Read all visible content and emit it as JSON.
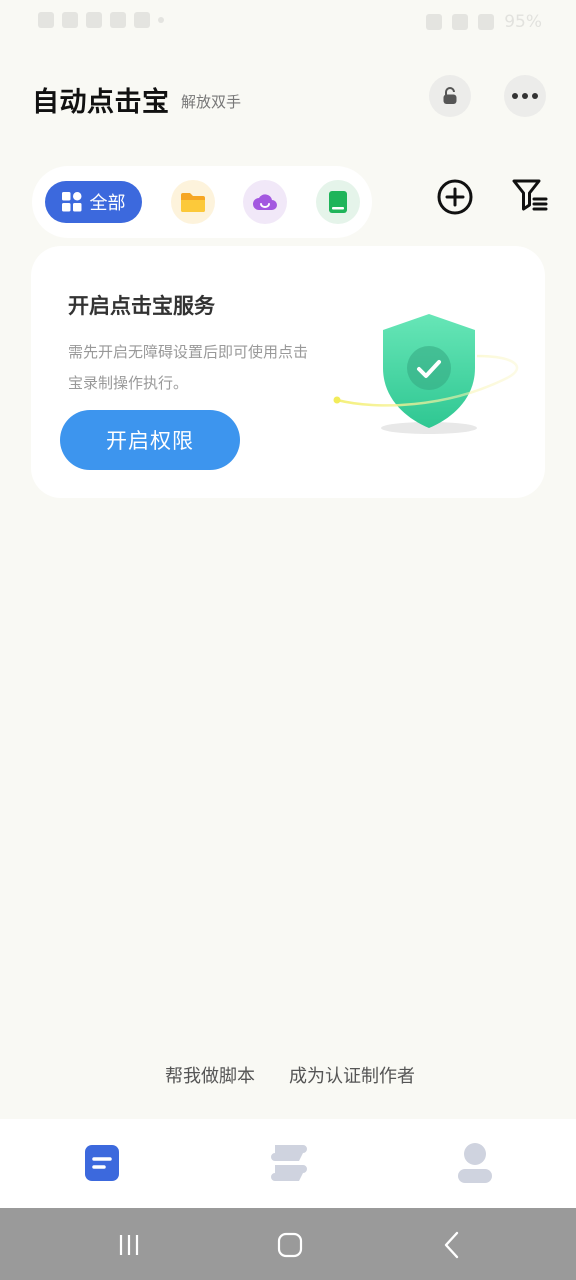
{
  "status_bar": {
    "battery_text": "95%"
  },
  "header": {
    "title": "自动点击宝",
    "subtitle": "解放双手",
    "lock_icon": "lock-icon",
    "more_icon": "more-dots-icon"
  },
  "categories": {
    "all_label": "全部",
    "items": [
      {
        "icon": "folder-icon",
        "color": "#f9b825"
      },
      {
        "icon": "cloud-icon",
        "color": "#a358e0"
      },
      {
        "icon": "book-icon",
        "color": "#1fb45a"
      }
    ]
  },
  "service_card": {
    "title": "开启点击宝服务",
    "description": "需先开启无障碍设置后即可使用点击宝录制操作执行。",
    "button_label": "开启权限"
  },
  "links": {
    "help_script": "帮我做脚本",
    "become_author": "成为认证制作者"
  },
  "colors": {
    "accent": "#3c69dd",
    "button_blue": "#3d95ee",
    "background": "#f9f9f4",
    "shield_green": "#3fd3a0"
  }
}
